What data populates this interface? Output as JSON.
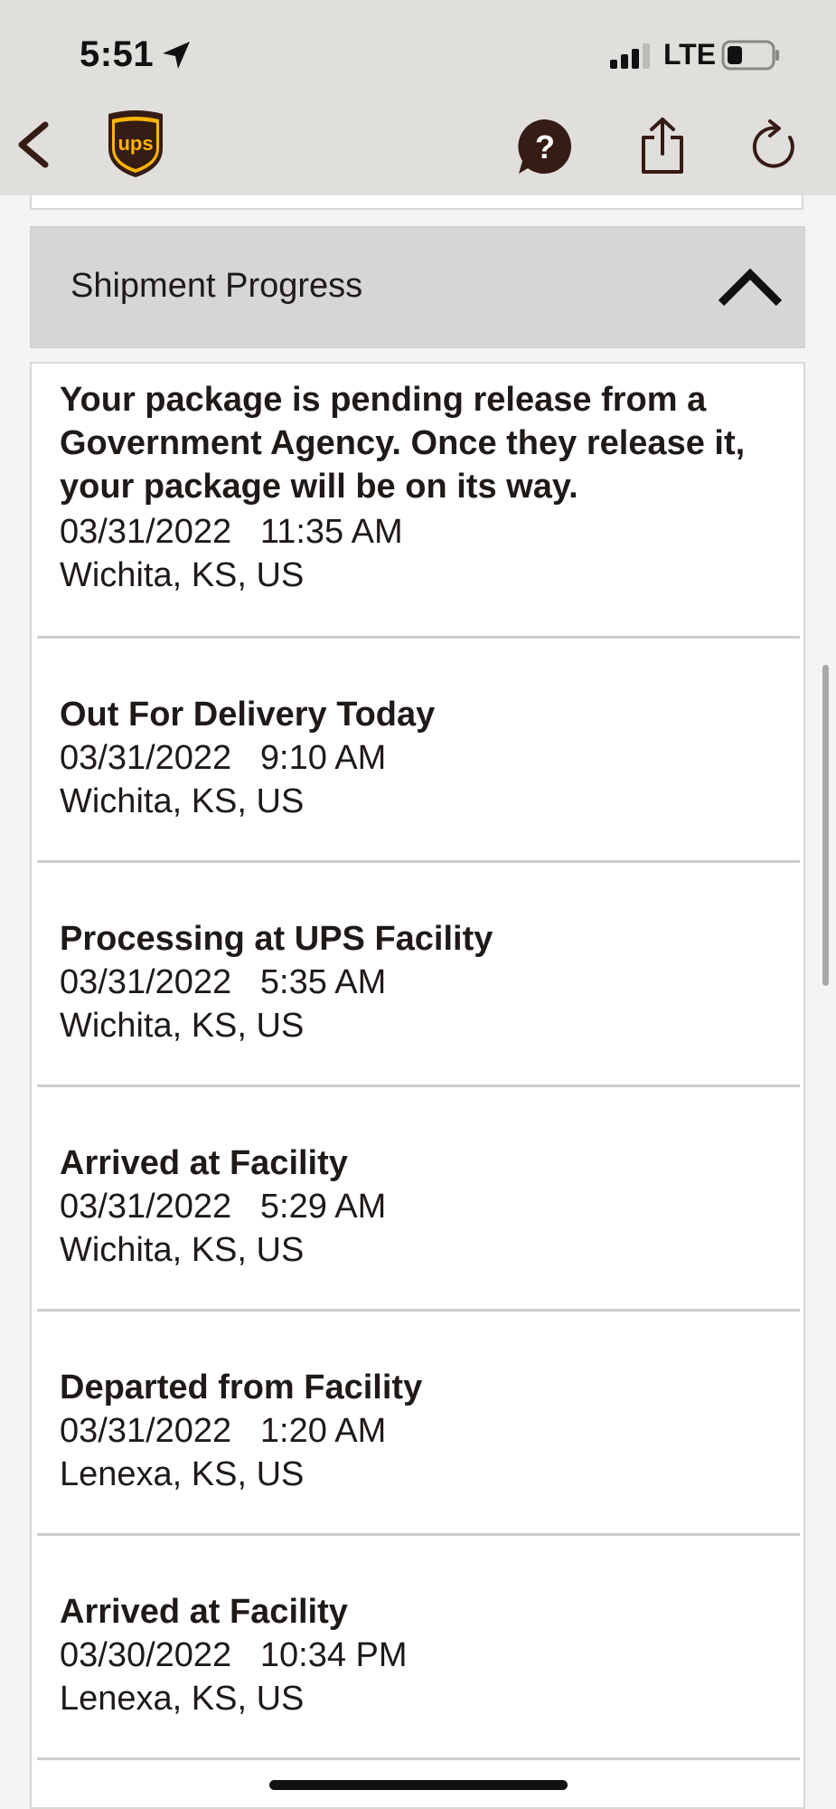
{
  "status_bar": {
    "time": "5:51",
    "network": "LTE",
    "icons": [
      "location-arrow-icon",
      "signal-icon",
      "battery-icon"
    ]
  },
  "nav": {
    "logo_text": "ups",
    "icons": [
      "back-chevron-icon",
      "help-icon",
      "share-icon",
      "refresh-icon"
    ],
    "colors": {
      "brand_brown": "#351c15",
      "brand_gold": "#ffb500"
    }
  },
  "section": {
    "title": "Shipment Progress",
    "toggle_icon": "chevron-up-icon"
  },
  "events": [
    {
      "title": "Your package is pending release from a Government Agency. Once they release it, your package will be on its way.",
      "date": "03/31/2022",
      "time": "11:35 AM",
      "location": "Wichita, KS, US"
    },
    {
      "title": "Out For Delivery Today",
      "date": "03/31/2022",
      "time": "9:10 AM",
      "location": "Wichita, KS, US"
    },
    {
      "title": "Processing at UPS Facility",
      "date": "03/31/2022",
      "time": "5:35 AM",
      "location": "Wichita, KS, US"
    },
    {
      "title": "Arrived at Facility",
      "date": "03/31/2022",
      "time": "5:29 AM",
      "location": "Wichita, KS, US"
    },
    {
      "title": "Departed from Facility",
      "date": "03/31/2022",
      "time": "1:20 AM",
      "location": "Lenexa, KS, US"
    },
    {
      "title": "Arrived at Facility",
      "date": "03/30/2022",
      "time": "10:34 PM",
      "location": "Lenexa, KS, US"
    }
  ]
}
